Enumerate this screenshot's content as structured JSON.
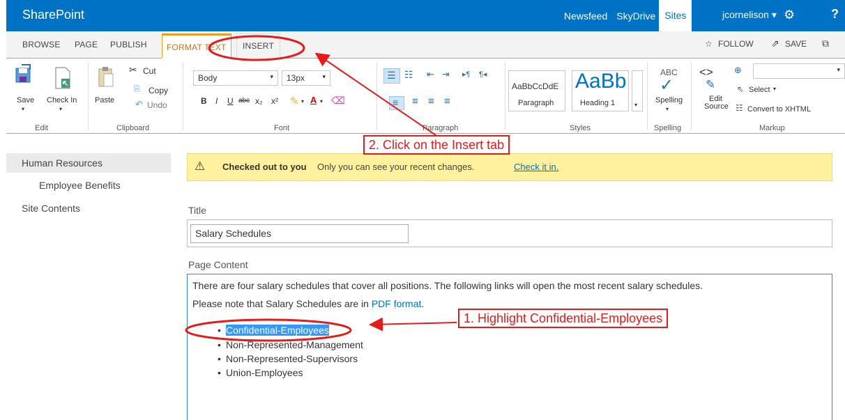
{
  "suite_bar": {
    "brand": "SharePoint",
    "links": [
      "Newsfeed",
      "SkyDrive",
      "Sites"
    ],
    "user": "jcornelison ▾",
    "gear_glyph": "⚙",
    "help_glyph": "?",
    "color": "#0072c6"
  },
  "ribbon_tabs": {
    "tabs": [
      "BROWSE",
      "PAGE",
      "PUBLISH",
      "FORMAT TEXT",
      "INSERT"
    ],
    "selected": "FORMAT TEXT",
    "follow": "FOLLOW",
    "save": "SAVE"
  },
  "ribbon": {
    "edit": {
      "save": "Save",
      "check_in": "Check In",
      "label": "Edit"
    },
    "clipboard": {
      "paste": "Paste",
      "cut": "Cut",
      "copy": "Copy",
      "undo": "Undo",
      "label": "Clipboard"
    },
    "font": {
      "style": "Body",
      "size": "13px",
      "label": "Font",
      "buttons": [
        "B",
        "I",
        "U",
        "abc",
        "x₂",
        "x²"
      ]
    },
    "paragraph": {
      "label": "Paragraph"
    },
    "styles": {
      "paragraph_sample": "AaBbCcDdE",
      "paragraph_name": "Paragraph",
      "heading_sample": "AaBb",
      "heading_name": "Heading 1",
      "label": "Styles"
    },
    "spelling": {
      "abc": "ABC",
      "name": "Spelling",
      "label": "Spelling"
    },
    "markup": {
      "edit_source_1": "Edit",
      "edit_source_2": "Source",
      "select": "Select",
      "convert": "Convert to XHTML",
      "label": "Markup"
    }
  },
  "nav": {
    "items": [
      "Human Resources",
      "Employee Benefits",
      "Site Contents"
    ]
  },
  "status": {
    "bold": "Checked out to you",
    "text": "Only you can see your recent changes.",
    "link": "Check it in."
  },
  "form": {
    "title_label": "Title",
    "title_value": "Salary Schedules",
    "content_label": "Page Content",
    "line1": "There are four salary schedules that cover all positions. The following links will open the most recent salary schedules.",
    "line2_prefix": "Please note that Salary Schedules are in ",
    "line2_link": "PDF format",
    "line2_suffix": ".",
    "bullets": [
      "Confidential-Employees",
      "Non-Represented-Management",
      "Non-Represented-Supervisors",
      "Union-Employees"
    ]
  },
  "annotations": {
    "step1": "1. Highlight Confidential-Employees",
    "step2": "2. Click on the Insert tab",
    "color": "#e51a1a"
  }
}
